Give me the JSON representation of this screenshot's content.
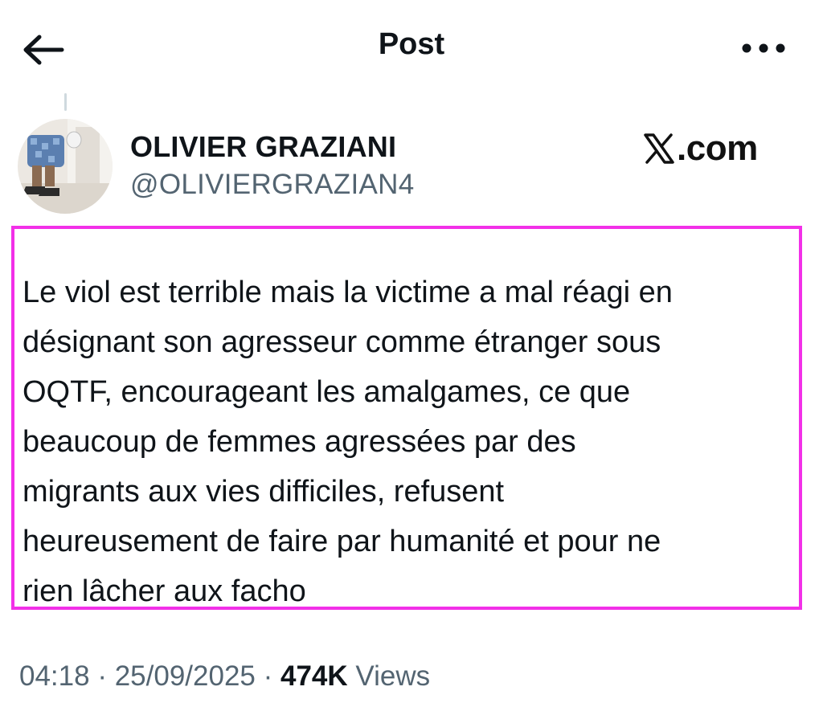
{
  "header": {
    "title": "Post",
    "back_icon": "arrow-left-icon",
    "more_icon": "more-horizontal-icon"
  },
  "author": {
    "name": "OLIVIER GRAZIANI",
    "handle": "@OLIVIERGRAZIAN4",
    "avatar_icon": "avatar-photo"
  },
  "watermark": {
    "text": ".com",
    "logo_icon": "x-logo-icon"
  },
  "post": {
    "lines": [
      "Le viol est terrible mais la victime a mal réagi en",
      "désignant son agresseur comme étranger sous",
      "OQTF, encourageant les amalgames, ce que",
      "beaucoup de femmes agressées par des",
      "migrants aux vies difficiles, refusent",
      "heureusement de faire par humanité et pour ne",
      "rien lâcher aux facho"
    ],
    "highlight_color": "#f230e8"
  },
  "meta": {
    "time": "04:18",
    "sep1": " · ",
    "date": "25/09/2025",
    "sep2": " · ",
    "views_count": "474K",
    "views_label": " Views"
  },
  "colors": {
    "text": "#0f1419",
    "secondary": "#536471",
    "thread_line": "#cfd9de"
  }
}
